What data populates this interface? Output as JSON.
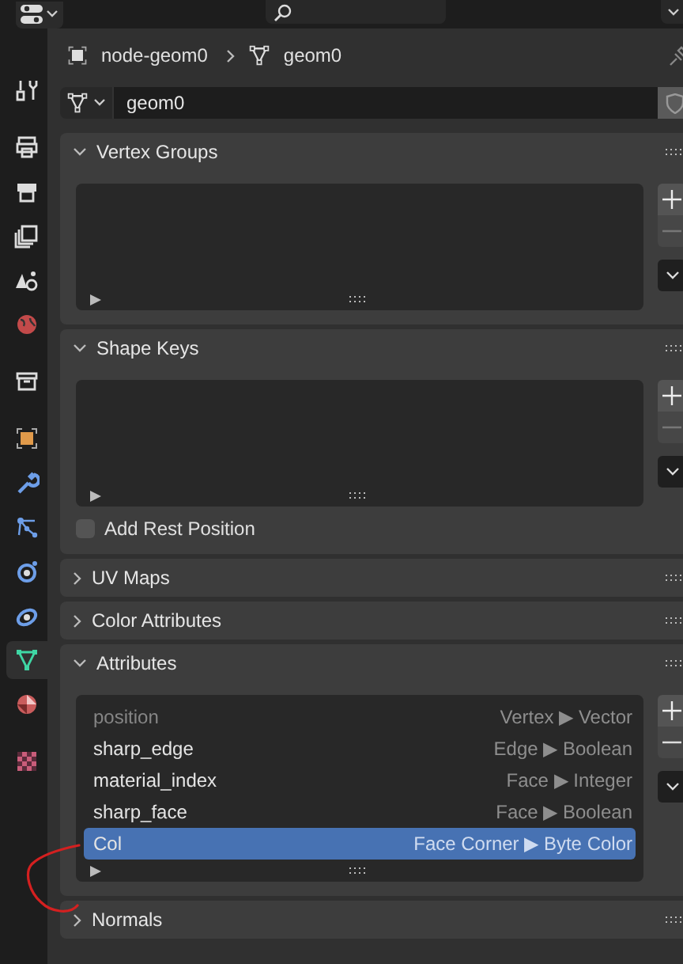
{
  "sidebar": {
    "tab_groups": [
      [
        {
          "kind": "tool",
          "selected": false
        }
      ],
      [
        {
          "kind": "render",
          "selected": false
        },
        {
          "kind": "output",
          "selected": false
        },
        {
          "kind": "view_layer",
          "selected": false
        },
        {
          "kind": "scene",
          "selected": false
        },
        {
          "kind": "world",
          "selected": false
        }
      ],
      [
        {
          "kind": "collection",
          "selected": false
        }
      ],
      [
        {
          "kind": "object",
          "selected": false
        },
        {
          "kind": "modifiers",
          "selected": false
        },
        {
          "kind": "particles",
          "selected": false
        },
        {
          "kind": "physics",
          "selected": false
        },
        {
          "kind": "constraints",
          "selected": false
        },
        {
          "kind": "data",
          "selected": true
        },
        {
          "kind": "material",
          "selected": false
        }
      ],
      [
        {
          "kind": "texture",
          "selected": false
        }
      ]
    ]
  },
  "breadcrumb": {
    "object": "node-geom0",
    "data": "geom0"
  },
  "datablock": {
    "name": "geom0"
  },
  "panels": [
    {
      "title": "Vertex Groups",
      "expanded": true
    },
    {
      "title": "Shape Keys",
      "expanded": true,
      "checkbox": {
        "label": "Add Rest Position",
        "checked": false
      }
    },
    {
      "title": "UV Maps",
      "expanded": false
    },
    {
      "title": "Color Attributes",
      "expanded": false
    },
    {
      "title": "Attributes",
      "expanded": true,
      "rows": [
        {
          "name": "position",
          "detail": "Vertex ▶ Vector",
          "disabled": true,
          "selected": false
        },
        {
          "name": "sharp_edge",
          "detail": "Edge ▶ Boolean",
          "disabled": false,
          "selected": false
        },
        {
          "name": "material_index",
          "detail": "Face ▶ Integer",
          "disabled": false,
          "selected": false
        },
        {
          "name": "sharp_face",
          "detail": "Face ▶ Boolean",
          "disabled": false,
          "selected": false
        },
        {
          "name": "Col",
          "detail": "Face Corner ▶ Byte Color",
          "disabled": false,
          "selected": true
        }
      ]
    },
    {
      "title": "Normals",
      "expanded": false
    }
  ]
}
